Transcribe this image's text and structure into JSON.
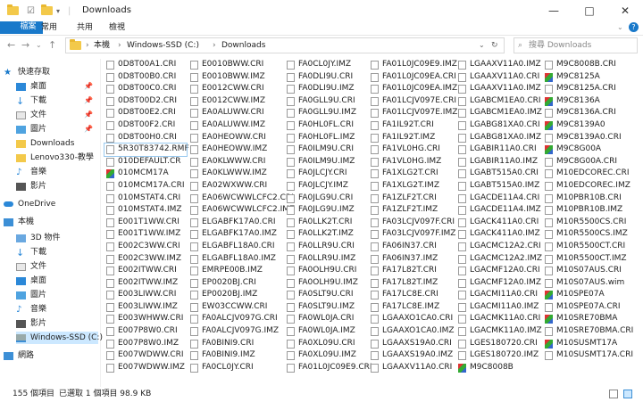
{
  "window": {
    "title": "Downloads",
    "minimize": "—",
    "maximize": "□",
    "close": "✕",
    "help": "?"
  },
  "ribbon": {
    "tabs": [
      "檔案",
      "常用",
      "共用",
      "檢視"
    ]
  },
  "address": {
    "crumbs": [
      "本機",
      "Windows-SSD (C:)",
      "Downloads"
    ],
    "search_placeholder": "搜尋 Downloads"
  },
  "sidebar": {
    "quick_access": "快速存取",
    "items": [
      {
        "label": "桌面",
        "pinned": true
      },
      {
        "label": "下載",
        "pinned": true
      },
      {
        "label": "文件",
        "pinned": true
      },
      {
        "label": "圖片",
        "pinned": true
      },
      {
        "label": "Downloads",
        "pinned": false
      },
      {
        "label": "Lenovo330-教學",
        "pinned": false
      },
      {
        "label": "音樂",
        "pinned": false
      },
      {
        "label": "影片",
        "pinned": false
      }
    ],
    "onedrive": "OneDrive",
    "this_pc": "本機",
    "pc_items": [
      "3D 物件",
      "下載",
      "文件",
      "桌面",
      "圖片",
      "音樂",
      "影片",
      "Windows-SSD (C:)"
    ],
    "network": "網路"
  },
  "files": [
    [
      "0D8T00A1.CRI",
      "0D8T00B0.CRI",
      "0D8T00C0.CRI",
      "0D8T00D2.CRI",
      "0D8T00E2.CRI",
      "0D8T00F2.CRI",
      "0D8T00H0.CRI",
      "5R30T83742.RMF",
      "010DEFAULT.CR",
      "010MCM17A",
      "010MCM17A.CRI",
      "010MSTAT4.CRI",
      "010MSTAT4.IMZ",
      "E001T1WW.CRI",
      "E001T1WW.IMZ",
      "E002C3WW.CRI",
      "E002C3WW.IMZ",
      "E002ITWW.CRI",
      "E002ITWW.IMZ",
      "E003LIWW.CRI",
      "E003LIWW.IMZ",
      "E003WHWW.CRI",
      "E007P8W0.CRI",
      "E007P8W0.IMZ",
      "E007WDWW.CRI",
      "E007WDWW.IMZ"
    ],
    [
      "E0010BWW.CRI",
      "E0010BWW.IMZ",
      "E0012CWW.CRI",
      "E0012CWW.IMZ",
      "EA0ALUWW.CRI",
      "EA0ALUWW.IMZ",
      "EA0HEOWW.CRI",
      "EA0HEOWW.IMZ",
      "EA0KLWWW.CRI",
      "EA0KLWWW.IMZ",
      "EA02WXWW.CRI",
      "EA06WCWWLCFC2.CRI",
      "EA06WCWWLCFC2.IMZ",
      "ELGABFK17A0.CRI",
      "ELGABFK17A0.IMZ",
      "ELGABFL18A0.CRI",
      "ELGABFL18A0.IMZ",
      "EMRPE00B.IMZ",
      "EP0020BJ.CRI",
      "EP0020BJ.IMZ",
      "EW03CCWW.CRI",
      "FA0ALCJV097G.CRI",
      "FA0ALCJV097G.IMZ",
      "FA0BINI9.CRI",
      "FA0BINI9.IMZ",
      "FA0CL0JY.CRI"
    ],
    [
      "FA0CL0JY.IMZ",
      "FA0DLI9U.CRI",
      "FA0DLI9U.IMZ",
      "FA0GLL9U.CRI",
      "FA0GLL9U.IMZ",
      "FA0HL0FL.CRI",
      "FA0HL0FL.IMZ",
      "FA0ILM9U.CRI",
      "FA0ILM9U.IMZ",
      "FA0JLCJY.CRI",
      "FA0JLCJY.IMZ",
      "FA0JLG9U.CRI",
      "FA0JLG9U.IMZ",
      "FA0LLK2T.CRI",
      "FA0LLK2T.IMZ",
      "FA0LLR9U.CRI",
      "FA0LLR9U.IMZ",
      "FA0OLH9U.CRI",
      "FA0OLH9U.IMZ",
      "FA0SLT9U.CRI",
      "FA0SLT9U.IMZ",
      "FA0WL0JA.CRI",
      "FA0WL0JA.IMZ",
      "FA0XL09U.CRI",
      "FA0XL09U.IMZ",
      "FA01L0JC09E9.CRI"
    ],
    [
      "FA01L0JC09E9.IMZ",
      "FA01L0JC09EA.CRI",
      "FA01L0JC09EA.IMZ",
      "FA01LCJV097E.CRI",
      "FA01LCJV097E.IMZ",
      "FA1IL92T.CRI",
      "FA1IL92T.IMZ",
      "FA1VL0HG.CRI",
      "FA1VL0HG.IMZ",
      "FA1XLG2T.CRI",
      "FA1XLG2T.IMZ",
      "FA1ZLF2T.CRI",
      "FA1ZLF2T.IMZ",
      "FA03LCJV097F.CRI",
      "FA03LCJV097F.IMZ",
      "FA06IN37.CRI",
      "FA06IN37.IMZ",
      "FA17L82T.CRI",
      "FA17L82T.IMZ",
      "FA17LC8E.CRI",
      "FA17LC8E.IMZ",
      "LGAAXO1CA0.CRI",
      "LGAAXO1CA0.IMZ",
      "LGAAXS19A0.CRI",
      "LGAAXS19A0.IMZ",
      "LGAAXV11A0.CRI"
    ],
    [
      "LGAAXV11A0.IMZ",
      "LGAAXV11A0.CRI",
      "LGAAXV11A0.IMZ",
      "LGABCM1EA0.CRI",
      "LGABCM1EA0.IMZ",
      "LGABG81XA0.CRI",
      "LGABG81XA0.IMZ",
      "LGABIR11A0.CRI",
      "LGABIR11A0.IMZ",
      "LGABT515A0.CRI",
      "LGABT515A0.IMZ",
      "LGACDE11A4.CRI",
      "LGACDE11A4.IMZ",
      "LGACK411A0.CRI",
      "LGACK411A0.IMZ",
      "LGACMC12A2.CRI",
      "LGACMC12A2.IMZ",
      "LGACMF12A0.CRI",
      "LGACMF12A0.IMZ",
      "LGACMI11A0.CRI",
      "LGACMI11A0.IMZ",
      "LGACMK11A0.CRI",
      "LGACMK11A0.IMZ",
      "LGES180720.CRI",
      "LGES180720.IMZ",
      "M9C8008B"
    ],
    [
      "M9C8008B.CRI",
      "M9C8125A",
      "M9C8125A.CRI",
      "M9C8136A",
      "M9C8136A.CRI",
      "M9C8139A0",
      "M9C8139A0.CRI",
      "M9C8G00A",
      "M9C8G00A.CRI",
      "M10EDCOREC.CRI",
      "M10EDCOREC.IMZ",
      "M10PBR10B.CRI",
      "M10PBR10B.IMZ",
      "M10R5500CS.CRI",
      "M10R5500CS.IMZ",
      "M10R5500CT.CRI",
      "M10R5500CT.IMZ",
      "M10S07AUS.CRI",
      "M10S07AUS.wim",
      "M10SPE07A",
      "M10SPE07A.CRI",
      "M10SRE70BMA",
      "M10SRE70BMA.CRI",
      "M10SUSMT17A",
      "M10SUSMT17A.CRI"
    ]
  ],
  "apps": [
    "010MCM17A",
    "M9C8125A",
    "M9C8136A",
    "M9C8139A0",
    "M9C8G00A",
    "M10SPE07A",
    "M10SRE70BMA",
    "M10SUSMT17A",
    "M9C8008B"
  ],
  "selected_file": "5R30T83742.RMF",
  "status": {
    "count": "155 個項目",
    "selected": "已選取 1 個項目  98.9 KB"
  }
}
